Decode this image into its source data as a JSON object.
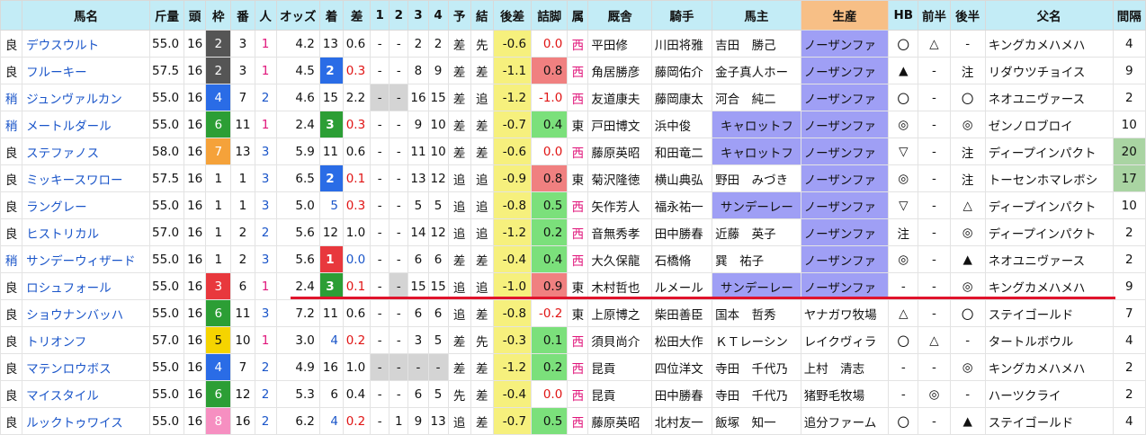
{
  "headers": [
    "",
    "馬名",
    "斤量",
    "頭",
    "枠",
    "番",
    "人",
    "オッズ",
    "着",
    "差",
    "1",
    "2",
    "3",
    "4",
    "予",
    "結",
    "後差",
    "詰脚",
    "属",
    "厩舎",
    "騎手",
    "馬主",
    "生産",
    "HB",
    "前半",
    "後半",
    "父名",
    "間隔"
  ],
  "colors": {
    "header_bg": "#c3ecf6",
    "production_header_bg": "#f7bf86",
    "gate": {
      "1": "#ffffff",
      "2": "#555555",
      "3": "#e8383d",
      "4": "#2a6ce6",
      "5": "#f5d400",
      "6": "#2c9e35",
      "7": "#f5a23a",
      "8": "#f68fc1"
    },
    "rank_1": "#e8383d",
    "rank_2": "#2a6ce6",
    "rank_3": "#2c9e35",
    "gap_negative": "#f6f07d",
    "gap_positive": "#f5b8b8",
    "owner_highlight": "#9f9ff5",
    "interval_highlight": "#a9d4a2",
    "divider_line": "#e0142c"
  },
  "rows": [
    {
      "cond": "良",
      "name": "デウスウルト",
      "kin": "55.0",
      "heads": "16",
      "gate": "2",
      "num": "3",
      "pop": "1",
      "odds": "4.2",
      "rank": "13",
      "diff": "0.6",
      "c1": "-",
      "c2": "-",
      "c3": "2",
      "c4": "2",
      "pred": "差",
      "res": "先",
      "kousa": "-0.6",
      "tsume": "0.0",
      "zoku": "西",
      "stable": "平田修",
      "jockey": "川田将雅",
      "owner": "吉田　勝己",
      "producer": "ノーザンファ",
      "hb": "〇",
      "zenhan": "△",
      "kouhan": "-",
      "sire": "キングカメハメハ",
      "interval": "4"
    },
    {
      "cond": "良",
      "name": "フルーキー",
      "kin": "57.5",
      "heads": "16",
      "gate": "2",
      "num": "3",
      "pop": "1",
      "odds": "4.5",
      "rank": "2",
      "diff": "0.3",
      "c1": "-",
      "c2": "-",
      "c3": "8",
      "c4": "9",
      "pred": "差",
      "res": "差",
      "kousa": "-1.1",
      "tsume": "0.8",
      "zoku": "西",
      "stable": "角居勝彦",
      "jockey": "藤岡佑介",
      "owner": "金子真人ホー",
      "producer": "ノーザンファ",
      "hb": "▲",
      "zenhan": "-",
      "kouhan": "注",
      "sire": "リダウツチョイス",
      "interval": "9"
    },
    {
      "cond": "稍",
      "name": "ジュンヴァルカン",
      "kin": "55.0",
      "heads": "16",
      "gate": "4",
      "num": "7",
      "pop": "2",
      "odds": "4.6",
      "rank": "15",
      "diff": "2.2",
      "c1": "-",
      "c2": "-",
      "c3": "16",
      "c4": "15",
      "pred": "差",
      "res": "追",
      "kousa": "-1.2",
      "tsume": "-1.0",
      "zoku": "西",
      "stable": "友道康夫",
      "jockey": "藤岡康太",
      "owner": "河合　純二",
      "producer": "ノーザンファ",
      "hb": "〇",
      "zenhan": "-",
      "kouhan": "〇",
      "sire": "ネオユニヴァース",
      "interval": "2"
    },
    {
      "cond": "稍",
      "name": "メートルダール",
      "kin": "55.0",
      "heads": "16",
      "gate": "6",
      "num": "11",
      "pop": "1",
      "odds": "2.4",
      "rank": "3",
      "diff": "0.3",
      "c1": "-",
      "c2": "-",
      "c3": "9",
      "c4": "10",
      "pred": "差",
      "res": "差",
      "kousa": "-0.7",
      "tsume": "0.4",
      "zoku": "東",
      "stable": "戸田博文",
      "jockey": "浜中俊",
      "owner": "キャロットフ",
      "producer": "ノーザンファ",
      "hb": "◎",
      "zenhan": "-",
      "kouhan": "◎",
      "sire": "ゼンノロブロイ",
      "interval": "10"
    },
    {
      "cond": "良",
      "name": "ステファノス",
      "kin": "58.0",
      "heads": "16",
      "gate": "7",
      "num": "13",
      "pop": "3",
      "odds": "5.9",
      "rank": "11",
      "diff": "0.6",
      "c1": "-",
      "c2": "-",
      "c3": "11",
      "c4": "10",
      "pred": "差",
      "res": "差",
      "kousa": "-0.6",
      "tsume": "0.0",
      "zoku": "西",
      "stable": "藤原英昭",
      "jockey": "和田竜二",
      "owner": "キャロットフ",
      "producer": "ノーザンファ",
      "hb": "▽",
      "zenhan": "-",
      "kouhan": "注",
      "sire": "ディープインパクト",
      "interval": "20"
    },
    {
      "cond": "良",
      "name": "ミッキースワロー",
      "kin": "57.5",
      "heads": "16",
      "gate": "1",
      "num": "1",
      "pop": "3",
      "odds": "6.5",
      "rank": "2",
      "diff": "0.1",
      "c1": "-",
      "c2": "-",
      "c3": "13",
      "c4": "12",
      "pred": "追",
      "res": "追",
      "kousa": "-0.9",
      "tsume": "0.8",
      "zoku": "東",
      "stable": "菊沢隆徳",
      "jockey": "横山典弘",
      "owner": "野田　みづき",
      "producer": "ノーザンファ",
      "hb": "◎",
      "zenhan": "-",
      "kouhan": "注",
      "sire": "トーセンホマレボシ",
      "interval": "17"
    },
    {
      "cond": "良",
      "name": "ラングレー",
      "kin": "55.0",
      "heads": "16",
      "gate": "1",
      "num": "1",
      "pop": "3",
      "odds": "5.0",
      "rank": "5",
      "diff": "0.3",
      "c1": "-",
      "c2": "-",
      "c3": "5",
      "c4": "5",
      "pred": "追",
      "res": "追",
      "kousa": "-0.8",
      "tsume": "0.5",
      "zoku": "西",
      "stable": "矢作芳人",
      "jockey": "福永祐一",
      "owner": "サンデーレー",
      "producer": "ノーザンファ",
      "hb": "▽",
      "zenhan": "-",
      "kouhan": "△",
      "sire": "ディープインパクト",
      "interval": "10"
    },
    {
      "cond": "良",
      "name": "ヒストリカル",
      "kin": "57.0",
      "heads": "16",
      "gate": "1",
      "num": "2",
      "pop": "2",
      "odds": "5.6",
      "rank": "12",
      "diff": "1.0",
      "c1": "-",
      "c2": "-",
      "c3": "14",
      "c4": "12",
      "pred": "追",
      "res": "追",
      "kousa": "-1.2",
      "tsume": "0.2",
      "zoku": "西",
      "stable": "音無秀孝",
      "jockey": "田中勝春",
      "owner": "近藤　英子",
      "producer": "ノーザンファ",
      "hb": "注",
      "zenhan": "-",
      "kouhan": "◎",
      "sire": "ディープインパクト",
      "interval": "2"
    },
    {
      "cond": "稍",
      "name": "サンデーウィザード",
      "kin": "55.0",
      "heads": "16",
      "gate": "1",
      "num": "2",
      "pop": "3",
      "odds": "5.6",
      "rank": "1",
      "diff": "0.0",
      "c1": "-",
      "c2": "-",
      "c3": "6",
      "c4": "6",
      "pred": "差",
      "res": "差",
      "kousa": "-0.4",
      "tsume": "0.4",
      "zoku": "西",
      "stable": "大久保龍",
      "jockey": "石橋脩",
      "owner": "巽　祐子",
      "producer": "ノーザンファ",
      "hb": "◎",
      "zenhan": "-",
      "kouhan": "▲",
      "sire": "ネオユニヴァース",
      "interval": "2"
    },
    {
      "cond": "良",
      "name": "ロシュフォール",
      "kin": "55.0",
      "heads": "16",
      "gate": "3",
      "num": "6",
      "pop": "1",
      "odds": "2.4",
      "rank": "3",
      "diff": "0.1",
      "c1": "-",
      "c2": "-",
      "c3": "15",
      "c4": "15",
      "pred": "追",
      "res": "追",
      "kousa": "-1.0",
      "tsume": "0.9",
      "zoku": "東",
      "stable": "木村哲也",
      "jockey": "ルメール",
      "owner": "サンデーレー",
      "producer": "ノーザンファ",
      "hb": "-",
      "zenhan": "-",
      "kouhan": "◎",
      "sire": "キングカメハメハ",
      "interval": "9"
    },
    {
      "cond": "良",
      "name": "ショウナンバッハ",
      "kin": "55.0",
      "heads": "16",
      "gate": "6",
      "num": "11",
      "pop": "3",
      "odds": "7.2",
      "rank": "11",
      "diff": "0.6",
      "c1": "-",
      "c2": "-",
      "c3": "6",
      "c4": "6",
      "pred": "追",
      "res": "差",
      "kousa": "-0.8",
      "tsume": "-0.2",
      "zoku": "東",
      "stable": "上原博之",
      "jockey": "柴田善臣",
      "owner": "国本　哲秀",
      "producer": "ヤナガワ牧場",
      "hb": "△",
      "zenhan": "-",
      "kouhan": "〇",
      "sire": "ステイゴールド",
      "interval": "7"
    },
    {
      "cond": "良",
      "name": "トリオンフ",
      "kin": "57.0",
      "heads": "16",
      "gate": "5",
      "num": "10",
      "pop": "1",
      "odds": "3.0",
      "rank": "4",
      "diff": "0.2",
      "c1": "-",
      "c2": "-",
      "c3": "3",
      "c4": "5",
      "pred": "差",
      "res": "先",
      "kousa": "-0.3",
      "tsume": "0.1",
      "zoku": "西",
      "stable": "須貝尚介",
      "jockey": "松田大作",
      "owner": "ＫＴレーシン",
      "producer": "レイクヴィラ",
      "hb": "〇",
      "zenhan": "△",
      "kouhan": "-",
      "sire": "タートルボウル",
      "interval": "4"
    },
    {
      "cond": "良",
      "name": "マテンロウボス",
      "kin": "55.0",
      "heads": "16",
      "gate": "4",
      "num": "7",
      "pop": "2",
      "odds": "4.9",
      "rank": "16",
      "diff": "1.0",
      "c1": "-",
      "c2": "-",
      "c3": "-",
      "c4": "-",
      "pred": "差",
      "res": "差",
      "kousa": "-1.2",
      "tsume": "0.2",
      "zoku": "西",
      "stable": "昆貢",
      "jockey": "四位洋文",
      "owner": "寺田　千代乃",
      "producer": "上村　清志",
      "hb": "-",
      "zenhan": "-",
      "kouhan": "◎",
      "sire": "キングカメハメハ",
      "interval": "2"
    },
    {
      "cond": "良",
      "name": "マイスタイル",
      "kin": "55.0",
      "heads": "16",
      "gate": "6",
      "num": "12",
      "pop": "2",
      "odds": "5.3",
      "rank": "6",
      "diff": "0.4",
      "c1": "-",
      "c2": "-",
      "c3": "6",
      "c4": "5",
      "pred": "先",
      "res": "差",
      "kousa": "-0.4",
      "tsume": "0.0",
      "zoku": "西",
      "stable": "昆貢",
      "jockey": "田中勝春",
      "owner": "寺田　千代乃",
      "producer": "猪野毛牧場",
      "hb": "-",
      "zenhan": "◎",
      "kouhan": "-",
      "sire": "ハーツクライ",
      "interval": "2"
    },
    {
      "cond": "良",
      "name": "ルックトゥワイス",
      "kin": "55.0",
      "heads": "16",
      "gate": "8",
      "num": "16",
      "pop": "2",
      "odds": "6.2",
      "rank": "4",
      "diff": "0.2",
      "c1": "-",
      "c2": "1",
      "c3": "9",
      "c4": "13",
      "pred": "追",
      "res": "差",
      "kousa": "-0.7",
      "tsume": "0.5",
      "zoku": "西",
      "stable": "藤原英昭",
      "jockey": "北村友一",
      "owner": "飯塚　知一",
      "producer": "追分ファーム",
      "hb": "〇",
      "zenhan": "-",
      "kouhan": "▲",
      "sire": "ステイゴールド",
      "interval": "4"
    }
  ]
}
